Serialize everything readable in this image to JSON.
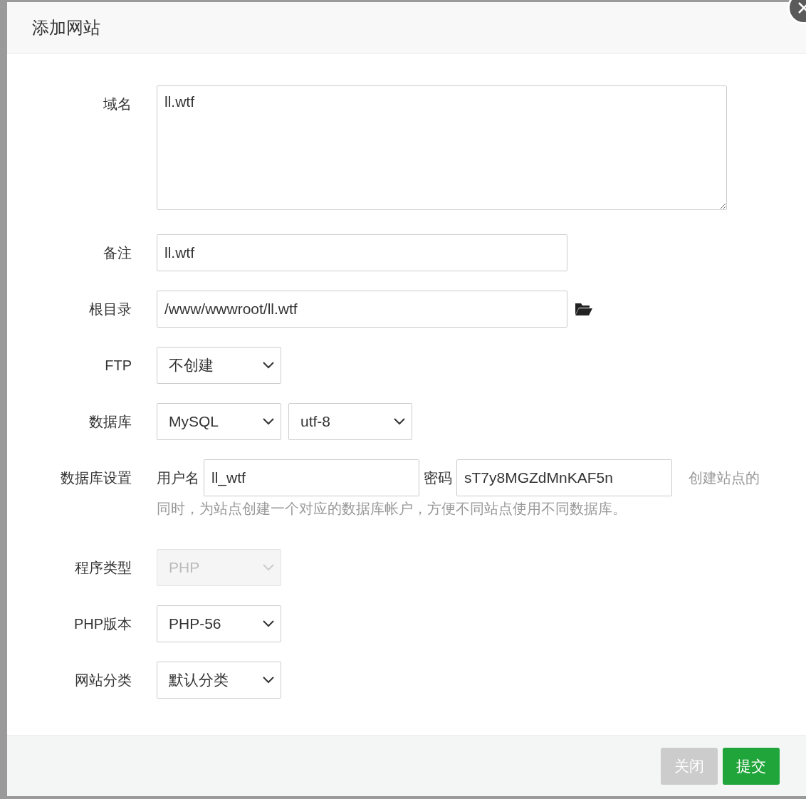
{
  "dialog": {
    "title": "添加网站"
  },
  "fields": [
    {
      "kind": "textarea",
      "label": "域名",
      "value": "ll.wtf"
    },
    {
      "kind": "text",
      "label": "备注",
      "value": "ll.wtf"
    },
    {
      "kind": "path",
      "label": "根目录",
      "value": "/www/wwwroot/ll.wtf"
    },
    {
      "kind": "select",
      "label": "FTP",
      "selects": [
        {
          "value": "不创建",
          "disabled": false
        }
      ]
    },
    {
      "kind": "select",
      "label": "数据库",
      "selects": [
        {
          "value": "MySQL",
          "disabled": false
        },
        {
          "value": "utf-8",
          "disabled": false
        }
      ]
    },
    {
      "kind": "credentials",
      "label": "数据库设置",
      "username_label": "用户名",
      "username": "ll_wtf",
      "password_label": "密码",
      "password": "sT7y8MGZdMnKAF5n",
      "hint_line_1": "创建站点的",
      "hint_line_2": "同时，为站点创建一个对应的数据库帐户，方便不同站点使用不同数据库。"
    },
    {
      "kind": "select",
      "label": "程序类型",
      "selects": [
        {
          "value": "PHP",
          "disabled": true
        }
      ]
    },
    {
      "kind": "select",
      "label": "PHP版本",
      "selects": [
        {
          "value": "PHP-56",
          "disabled": false
        }
      ]
    },
    {
      "kind": "select",
      "label": "网站分类",
      "selects": [
        {
          "value": "默认分类",
          "disabled": false
        }
      ]
    }
  ],
  "buttons": [
    {
      "label": "关闭",
      "kind": "secondary"
    },
    {
      "label": "提交",
      "kind": "primary"
    }
  ]
}
